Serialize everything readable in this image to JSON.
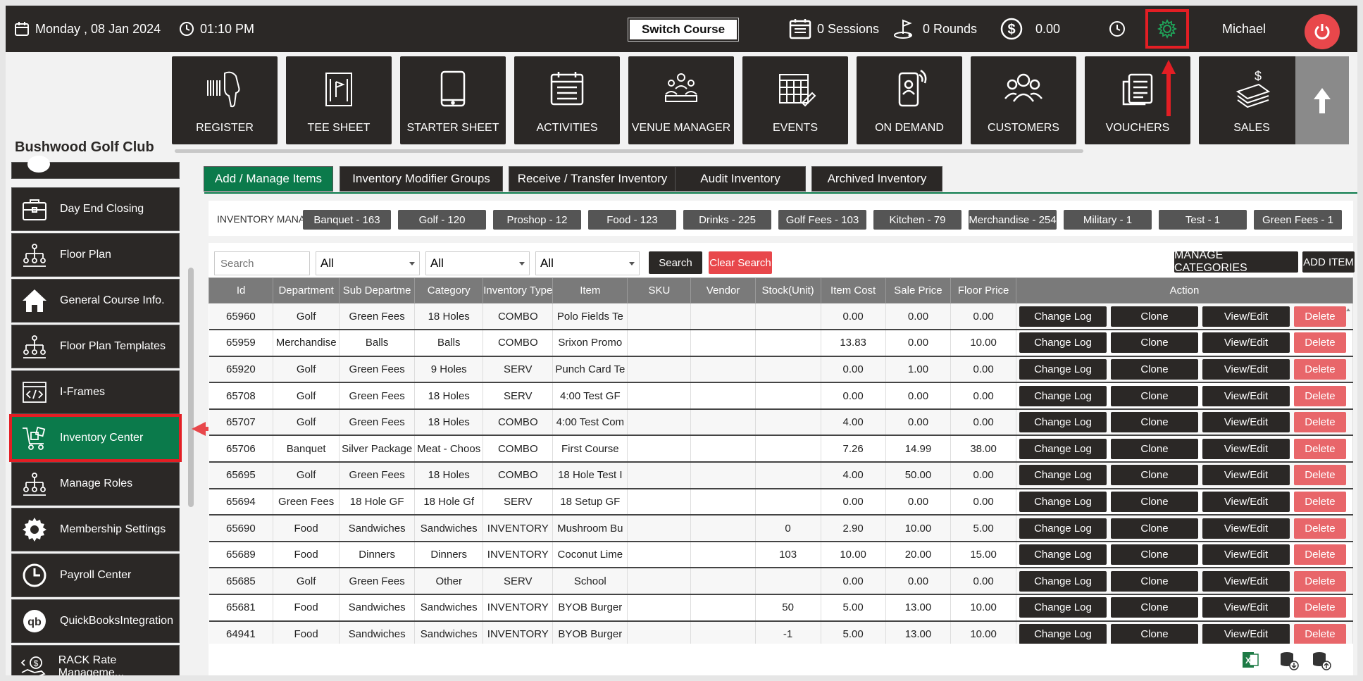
{
  "topbar": {
    "date": "Monday ,  08 Jan 2024",
    "time": "01:10 PM",
    "switch_course": "Switch Course",
    "sessions": "0 Sessions",
    "rounds": "0 Rounds",
    "balance": "0.00",
    "user": "Michael"
  },
  "club_name": "Bushwood Golf Club",
  "nav_tiles": [
    {
      "label": "REGISTER",
      "icon": "barcode-scanner-icon"
    },
    {
      "label": "TEE SHEET",
      "icon": "tee-sheet-icon"
    },
    {
      "label": "STARTER SHEET",
      "icon": "tablet-icon"
    },
    {
      "label": "ACTIVITIES",
      "icon": "calendar-list-icon"
    },
    {
      "label": "VENUE MANAGER",
      "icon": "venue-meeting-icon"
    },
    {
      "label": "EVENTS",
      "icon": "events-calendar-icon"
    },
    {
      "label": "ON DEMAND",
      "icon": "mobile-user-icon"
    },
    {
      "label": "CUSTOMERS",
      "icon": "customers-icon"
    },
    {
      "label": "VOUCHERS",
      "icon": "voucher-icon"
    },
    {
      "label": "SALES",
      "icon": "sales-money-icon"
    }
  ],
  "sidebar": {
    "items": [
      {
        "label": "Day End Closing",
        "icon": "briefcase-icon"
      },
      {
        "label": "Floor Plan",
        "icon": "org-chart-icon"
      },
      {
        "label": "General Course Info.",
        "icon": "home-icon"
      },
      {
        "label": "Floor Plan Templates",
        "icon": "org-chart-icon"
      },
      {
        "label": "I-Frames",
        "icon": "code-window-icon"
      },
      {
        "label": "Inventory Center",
        "icon": "inventory-cart-icon"
      },
      {
        "label": "Manage Roles",
        "icon": "org-chart-icon"
      },
      {
        "label": "Membership Settings",
        "icon": "gear-icon"
      },
      {
        "label": "Payroll Center",
        "icon": "clock-icon"
      },
      {
        "label": "QuickBooksIntegration",
        "icon": "quickbooks-icon"
      },
      {
        "label": "RACK Rate Manageme...",
        "icon": "rate-hand-icon"
      }
    ]
  },
  "tabs": [
    "Add / Manage Items",
    "Inventory Modifier Groups",
    "Receive / Transfer Inventory",
    "Audit Inventory",
    "Archived Inventory"
  ],
  "categories_label": "INVENTORY MANAG",
  "categories": [
    "Banquet - 163",
    "Golf - 120",
    "Proshop - 12",
    "Food - 123",
    "Drinks - 225",
    "Golf Fees - 103",
    "Kitchen - 79",
    "Merchandise - 254",
    "Military - 1",
    "Test - 1",
    "Green Fees - 1"
  ],
  "filters": {
    "search_placeholder": "Search",
    "select1": "All",
    "select2": "All",
    "select3": "All",
    "search_btn": "Search",
    "clear_btn": "Clear Search",
    "manage_btn": "MANAGE CATEGORIES",
    "add_btn": "ADD ITEM"
  },
  "table": {
    "headers": [
      "Id",
      "Department",
      "Sub Departme",
      "Category",
      "Inventory Type",
      "Item",
      "SKU",
      "Vendor",
      "Stock(Unit)",
      "Item Cost",
      "Sale Price",
      "Floor Price",
      "Action"
    ],
    "actions": {
      "change_log": "Change Log",
      "clone": "Clone",
      "view_edit": "View/Edit",
      "delete": "Delete"
    },
    "rows": [
      [
        "65960",
        "Golf",
        "Green Fees",
        "18 Holes",
        "COMBO",
        "Polo Fields Te",
        "",
        "",
        "",
        "0.00",
        "0.00",
        "0.00"
      ],
      [
        "65959",
        "Merchandise",
        "Balls",
        "Balls",
        "COMBO",
        "Srixon Promo",
        "",
        "",
        "",
        "13.83",
        "0.00",
        "10.00"
      ],
      [
        "65920",
        "Golf",
        "Green Fees",
        "9 Holes",
        "SERV",
        "Punch Card Te",
        "",
        "",
        "",
        "0.00",
        "1.00",
        "0.00"
      ],
      [
        "65708",
        "Golf",
        "Green Fees",
        "18 Holes",
        "SERV",
        "4:00 Test GF",
        "",
        "",
        "",
        "0.00",
        "0.00",
        "0.00"
      ],
      [
        "65707",
        "Golf",
        "Green Fees",
        "18 Holes",
        "COMBO",
        "4:00 Test Com",
        "",
        "",
        "",
        "4.00",
        "0.00",
        "0.00"
      ],
      [
        "65706",
        "Banquet",
        "Silver Package",
        "Meat - Choos",
        "COMBO",
        "First Course",
        "",
        "",
        "",
        "7.26",
        "14.99",
        "38.00"
      ],
      [
        "65695",
        "Golf",
        "Green Fees",
        "18 Holes",
        "COMBO",
        "18 Hole Test I",
        "",
        "",
        "",
        "4.00",
        "50.00",
        "0.00"
      ],
      [
        "65694",
        "Green Fees",
        "18 Hole GF",
        "18 Hole Gf",
        "SERV",
        "18 Setup GF",
        "",
        "",
        "",
        "0.00",
        "0.00",
        "0.00"
      ],
      [
        "65690",
        "Food",
        "Sandwiches",
        "Sandwiches",
        "INVENTORY",
        "Mushroom Bu",
        "",
        "",
        "0",
        "2.90",
        "10.00",
        "5.00"
      ],
      [
        "65689",
        "Food",
        "Dinners",
        "Dinners",
        "INVENTORY",
        "Coconut Lime",
        "",
        "",
        "103",
        "10.00",
        "20.00",
        "15.00"
      ],
      [
        "65685",
        "Golf",
        "Green Fees",
        "Other",
        "SERV",
        "School",
        "",
        "",
        "",
        "0.00",
        "0.00",
        "0.00"
      ],
      [
        "65681",
        "Food",
        "Sandwiches",
        "Sandwiches",
        "INVENTORY",
        "BYOB Burger",
        "",
        "",
        "50",
        "5.00",
        "13.00",
        "10.00"
      ],
      [
        "64941",
        "Food",
        "Sandwiches",
        "Sandwiches",
        "INVENTORY",
        "BYOB Burger",
        "",
        "",
        "-1",
        "5.00",
        "13.00",
        "10.00"
      ]
    ]
  },
  "colors": {
    "dark": "#2b2826",
    "accent_green": "#0b7a4b",
    "danger": "#e8474b",
    "highlight_red": "#e31e24"
  }
}
